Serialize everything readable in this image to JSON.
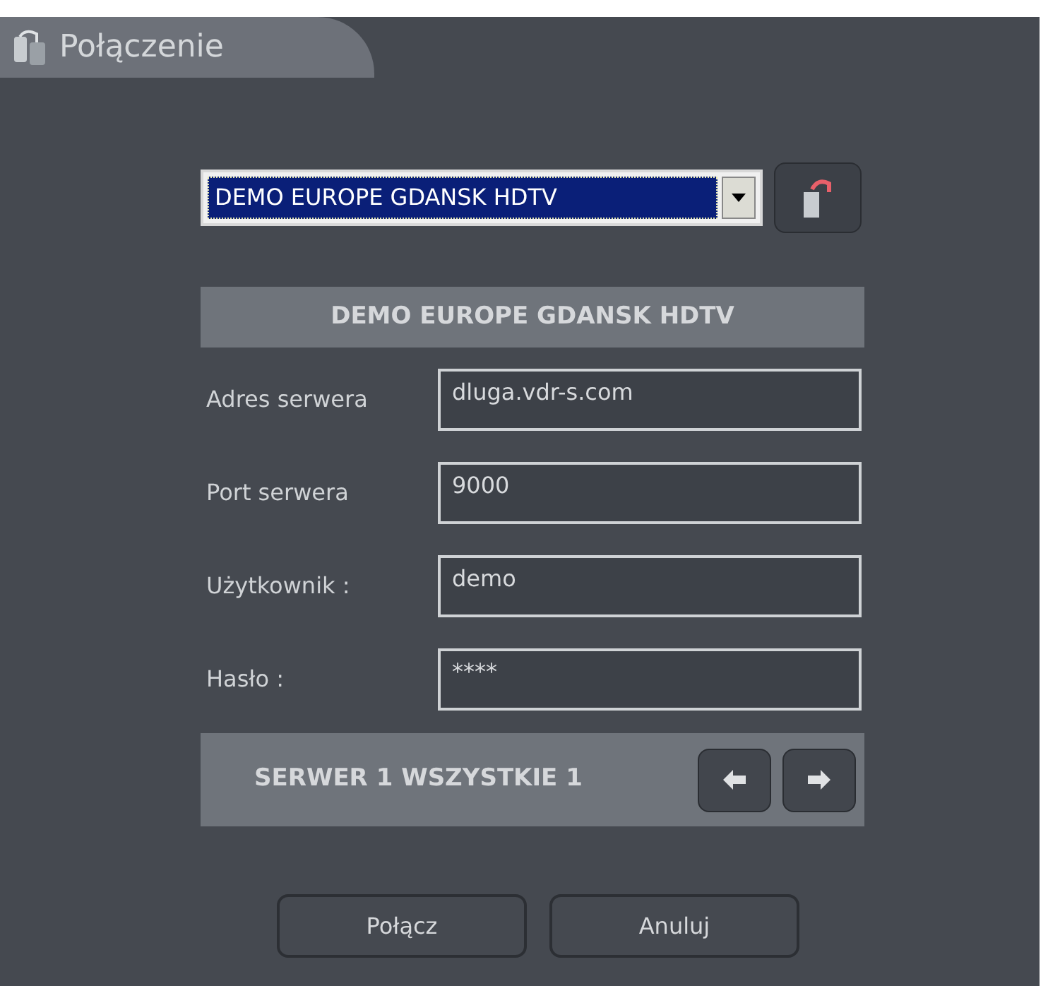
{
  "window": {
    "title": "Połączenie"
  },
  "server_select": {
    "value": "DEMO EUROPE GDANSK HDTV"
  },
  "server_header": "DEMO EUROPE GDANSK HDTV",
  "fields": [
    {
      "label": "Adres serwera",
      "value": "dluga.vdr-s.com"
    },
    {
      "label": "Port serwera",
      "value": "9000"
    },
    {
      "label": "Użytkownik :",
      "value": "demo"
    },
    {
      "label": "Hasło :",
      "value": "****"
    }
  ],
  "server_counter": "SERWER 1 WSZYSTKIE 1",
  "buttons": [
    "Połącz",
    "Anuluj"
  ]
}
